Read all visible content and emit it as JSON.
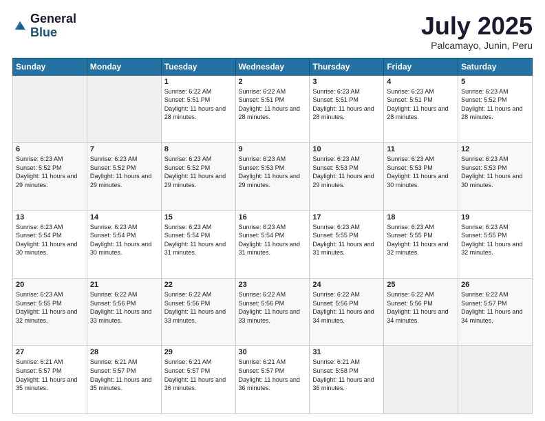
{
  "header": {
    "logo_general": "General",
    "logo_blue": "Blue",
    "title": "July 2025",
    "subtitle": "Palcamayo, Junin, Peru"
  },
  "days_of_week": [
    "Sunday",
    "Monday",
    "Tuesday",
    "Wednesday",
    "Thursday",
    "Friday",
    "Saturday"
  ],
  "weeks": [
    [
      {
        "day": "",
        "empty": true
      },
      {
        "day": "",
        "empty": true
      },
      {
        "day": "1",
        "sunrise": "Sunrise: 6:22 AM",
        "sunset": "Sunset: 5:51 PM",
        "daylight": "Daylight: 11 hours and 28 minutes."
      },
      {
        "day": "2",
        "sunrise": "Sunrise: 6:22 AM",
        "sunset": "Sunset: 5:51 PM",
        "daylight": "Daylight: 11 hours and 28 minutes."
      },
      {
        "day": "3",
        "sunrise": "Sunrise: 6:23 AM",
        "sunset": "Sunset: 5:51 PM",
        "daylight": "Daylight: 11 hours and 28 minutes."
      },
      {
        "day": "4",
        "sunrise": "Sunrise: 6:23 AM",
        "sunset": "Sunset: 5:51 PM",
        "daylight": "Daylight: 11 hours and 28 minutes."
      },
      {
        "day": "5",
        "sunrise": "Sunrise: 6:23 AM",
        "sunset": "Sunset: 5:52 PM",
        "daylight": "Daylight: 11 hours and 28 minutes."
      }
    ],
    [
      {
        "day": "6",
        "sunrise": "Sunrise: 6:23 AM",
        "sunset": "Sunset: 5:52 PM",
        "daylight": "Daylight: 11 hours and 29 minutes."
      },
      {
        "day": "7",
        "sunrise": "Sunrise: 6:23 AM",
        "sunset": "Sunset: 5:52 PM",
        "daylight": "Daylight: 11 hours and 29 minutes."
      },
      {
        "day": "8",
        "sunrise": "Sunrise: 6:23 AM",
        "sunset": "Sunset: 5:52 PM",
        "daylight": "Daylight: 11 hours and 29 minutes."
      },
      {
        "day": "9",
        "sunrise": "Sunrise: 6:23 AM",
        "sunset": "Sunset: 5:53 PM",
        "daylight": "Daylight: 11 hours and 29 minutes."
      },
      {
        "day": "10",
        "sunrise": "Sunrise: 6:23 AM",
        "sunset": "Sunset: 5:53 PM",
        "daylight": "Daylight: 11 hours and 29 minutes."
      },
      {
        "day": "11",
        "sunrise": "Sunrise: 6:23 AM",
        "sunset": "Sunset: 5:53 PM",
        "daylight": "Daylight: 11 hours and 30 minutes."
      },
      {
        "day": "12",
        "sunrise": "Sunrise: 6:23 AM",
        "sunset": "Sunset: 5:53 PM",
        "daylight": "Daylight: 11 hours and 30 minutes."
      }
    ],
    [
      {
        "day": "13",
        "sunrise": "Sunrise: 6:23 AM",
        "sunset": "Sunset: 5:54 PM",
        "daylight": "Daylight: 11 hours and 30 minutes."
      },
      {
        "day": "14",
        "sunrise": "Sunrise: 6:23 AM",
        "sunset": "Sunset: 5:54 PM",
        "daylight": "Daylight: 11 hours and 30 minutes."
      },
      {
        "day": "15",
        "sunrise": "Sunrise: 6:23 AM",
        "sunset": "Sunset: 5:54 PM",
        "daylight": "Daylight: 11 hours and 31 minutes."
      },
      {
        "day": "16",
        "sunrise": "Sunrise: 6:23 AM",
        "sunset": "Sunset: 5:54 PM",
        "daylight": "Daylight: 11 hours and 31 minutes."
      },
      {
        "day": "17",
        "sunrise": "Sunrise: 6:23 AM",
        "sunset": "Sunset: 5:55 PM",
        "daylight": "Daylight: 11 hours and 31 minutes."
      },
      {
        "day": "18",
        "sunrise": "Sunrise: 6:23 AM",
        "sunset": "Sunset: 5:55 PM",
        "daylight": "Daylight: 11 hours and 32 minutes."
      },
      {
        "day": "19",
        "sunrise": "Sunrise: 6:23 AM",
        "sunset": "Sunset: 5:55 PM",
        "daylight": "Daylight: 11 hours and 32 minutes."
      }
    ],
    [
      {
        "day": "20",
        "sunrise": "Sunrise: 6:23 AM",
        "sunset": "Sunset: 5:55 PM",
        "daylight": "Daylight: 11 hours and 32 minutes."
      },
      {
        "day": "21",
        "sunrise": "Sunrise: 6:22 AM",
        "sunset": "Sunset: 5:56 PM",
        "daylight": "Daylight: 11 hours and 33 minutes."
      },
      {
        "day": "22",
        "sunrise": "Sunrise: 6:22 AM",
        "sunset": "Sunset: 5:56 PM",
        "daylight": "Daylight: 11 hours and 33 minutes."
      },
      {
        "day": "23",
        "sunrise": "Sunrise: 6:22 AM",
        "sunset": "Sunset: 5:56 PM",
        "daylight": "Daylight: 11 hours and 33 minutes."
      },
      {
        "day": "24",
        "sunrise": "Sunrise: 6:22 AM",
        "sunset": "Sunset: 5:56 PM",
        "daylight": "Daylight: 11 hours and 34 minutes."
      },
      {
        "day": "25",
        "sunrise": "Sunrise: 6:22 AM",
        "sunset": "Sunset: 5:56 PM",
        "daylight": "Daylight: 11 hours and 34 minutes."
      },
      {
        "day": "26",
        "sunrise": "Sunrise: 6:22 AM",
        "sunset": "Sunset: 5:57 PM",
        "daylight": "Daylight: 11 hours and 34 minutes."
      }
    ],
    [
      {
        "day": "27",
        "sunrise": "Sunrise: 6:21 AM",
        "sunset": "Sunset: 5:57 PM",
        "daylight": "Daylight: 11 hours and 35 minutes."
      },
      {
        "day": "28",
        "sunrise": "Sunrise: 6:21 AM",
        "sunset": "Sunset: 5:57 PM",
        "daylight": "Daylight: 11 hours and 35 minutes."
      },
      {
        "day": "29",
        "sunrise": "Sunrise: 6:21 AM",
        "sunset": "Sunset: 5:57 PM",
        "daylight": "Daylight: 11 hours and 36 minutes."
      },
      {
        "day": "30",
        "sunrise": "Sunrise: 6:21 AM",
        "sunset": "Sunset: 5:57 PM",
        "daylight": "Daylight: 11 hours and 36 minutes."
      },
      {
        "day": "31",
        "sunrise": "Sunrise: 6:21 AM",
        "sunset": "Sunset: 5:58 PM",
        "daylight": "Daylight: 11 hours and 36 minutes."
      },
      {
        "day": "",
        "empty": true
      },
      {
        "day": "",
        "empty": true
      }
    ]
  ]
}
